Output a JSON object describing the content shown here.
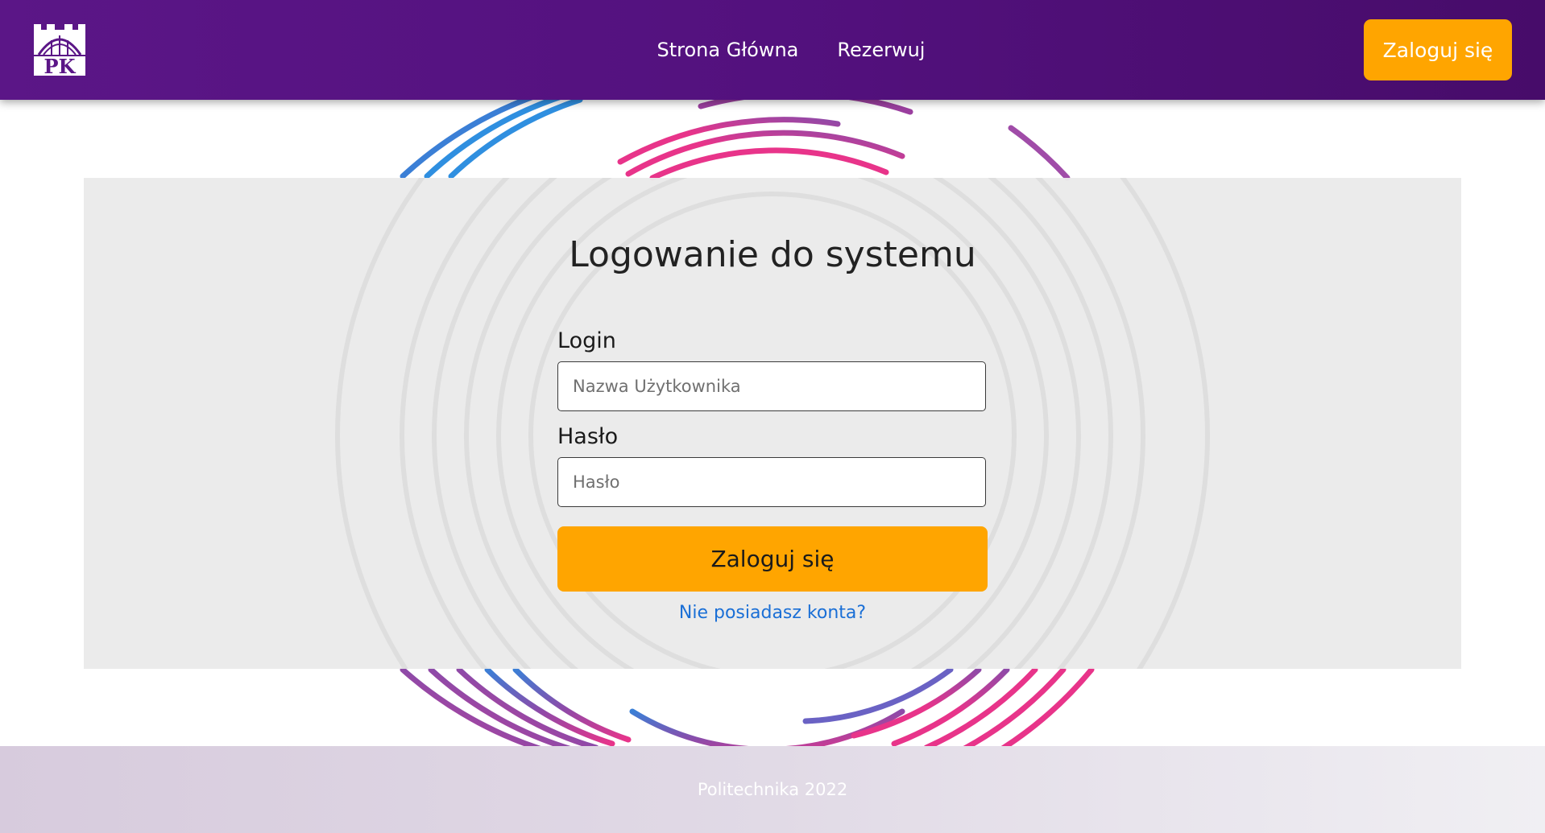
{
  "navbar": {
    "logo_icon": "politechnika-krakowska-logo-icon",
    "logo_text": "PK",
    "links": [
      {
        "label": "Strona Główna"
      },
      {
        "label": "Rezerwuj"
      }
    ],
    "login_button": "Zaloguj się"
  },
  "login_form": {
    "title": "Logowanie do systemu",
    "login_label": "Login",
    "login_placeholder": "Nazwa Użytkownika",
    "login_value": "",
    "password_label": "Hasło",
    "password_placeholder": "Hasło",
    "password_value": "",
    "submit_label": "Zaloguj się",
    "register_link": "Nie posiadasz konta?"
  },
  "footer": {
    "text": "Politechnika 2022"
  },
  "colors": {
    "navbar": "#53117e",
    "accent": "#ffa500",
    "link": "#1a6fd6",
    "ring_pink": "#e8348a",
    "ring_purple": "#8e4aa8",
    "ring_blue": "#3b7fd6"
  }
}
